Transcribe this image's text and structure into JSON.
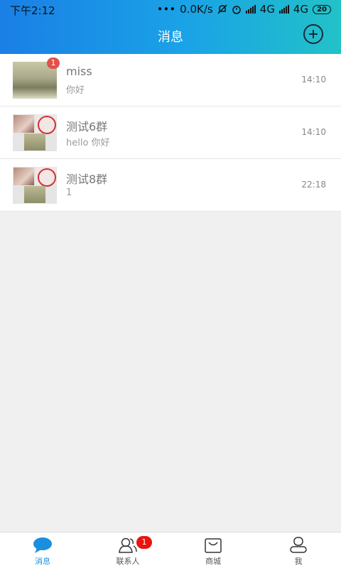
{
  "status_bar": {
    "time": "下午2:12",
    "net_speed": "0.0K/s",
    "network_1": "4G",
    "network_2": "4G",
    "battery": "20"
  },
  "header": {
    "title": "消息",
    "add_icon": "plus-circle-icon"
  },
  "chats": [
    {
      "name": "miss",
      "preview": "你好",
      "time": "14:10",
      "badge": "1",
      "avatar_type": "single"
    },
    {
      "name": "测试6群",
      "preview": "hello 你好",
      "time": "14:10",
      "badge": "",
      "avatar_type": "group"
    },
    {
      "name": "测试8群",
      "preview": "1",
      "time": "22:18",
      "badge": "",
      "avatar_type": "group"
    }
  ],
  "tabbar": {
    "tabs": [
      {
        "label": "消息",
        "icon": "chat-bubble-icon",
        "active": true
      },
      {
        "label": "联系人",
        "icon": "contacts-icon",
        "badge": "1"
      },
      {
        "label": "商城",
        "icon": "shopping-bag-icon"
      },
      {
        "label": "我",
        "icon": "user-icon"
      }
    ]
  },
  "colors": {
    "accent": "#1a8fe0",
    "header_gradient_start": "#1a7fe6",
    "header_gradient_end": "#22c2c8",
    "badge_red": "#e3504a"
  }
}
